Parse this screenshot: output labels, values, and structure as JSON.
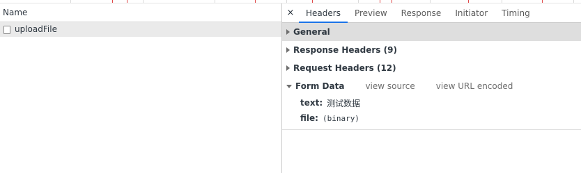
{
  "network_list": {
    "column_header": "Name",
    "rows": [
      {
        "name": "uploadFile"
      }
    ]
  },
  "details": {
    "tabs": [
      {
        "label": "Headers",
        "active": true
      },
      {
        "label": "Preview",
        "active": false
      },
      {
        "label": "Response",
        "active": false
      },
      {
        "label": "Initiator",
        "active": false
      },
      {
        "label": "Timing",
        "active": false
      }
    ],
    "close_glyph": "×",
    "sections": {
      "general": "General",
      "response_headers": "Response Headers (9)",
      "request_headers": "Request Headers (12)",
      "form_data": "Form Data"
    },
    "form_data_links": {
      "view_source": "view source",
      "view_url_encoded": "view URL encoded"
    },
    "form_fields": [
      {
        "key": "text:",
        "value": "测试数据"
      },
      {
        "key": "file:",
        "value": "(binary)"
      }
    ]
  },
  "colors": {
    "active_tab_underline": "#1a73e8",
    "selected_row_bg": "#eaeaea",
    "general_row_bg": "#dedede"
  },
  "icons": {
    "close": "close-icon",
    "file": "file-icon",
    "collapsed": "triangle-right-icon",
    "expanded": "triangle-down-icon"
  }
}
